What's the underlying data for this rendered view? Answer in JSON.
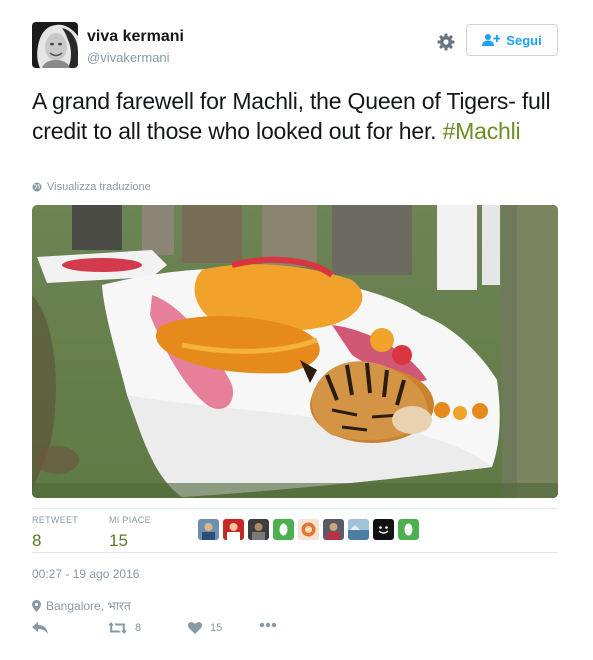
{
  "user": {
    "name": "viva kermani",
    "handle": "@vivakermani"
  },
  "follow_button": {
    "label": "Segui",
    "icon": "user-plus-icon"
  },
  "settings_icon": "gear-icon",
  "tweet": {
    "text": "A grand farewell for Machli, the Queen of Tigers- full credit to all those  who looked out for her. ",
    "hashtag": "#Machli",
    "translate_link": "Visualizza traduzione"
  },
  "stats": {
    "retweets_label": "RETWEET",
    "retweets_value": "8",
    "likes_label": "MI PIACE",
    "likes_value": "15"
  },
  "timestamp": "00:27 - 19 ago 2016",
  "location": "Bangalore, भारत",
  "actions": {
    "reply_icon": "reply-icon",
    "retweet_icon": "retweet-icon",
    "retweet_count": "8",
    "like_icon": "heart-icon",
    "like_count": "15",
    "more_icon": "more-dots-icon"
  },
  "colors": {
    "accent_blue": "#1da1f2",
    "hashtag_green": "#6b8e23",
    "count_green": "#5b7a1f",
    "muted": "#8899a6",
    "divider": "#e1e8ed"
  }
}
